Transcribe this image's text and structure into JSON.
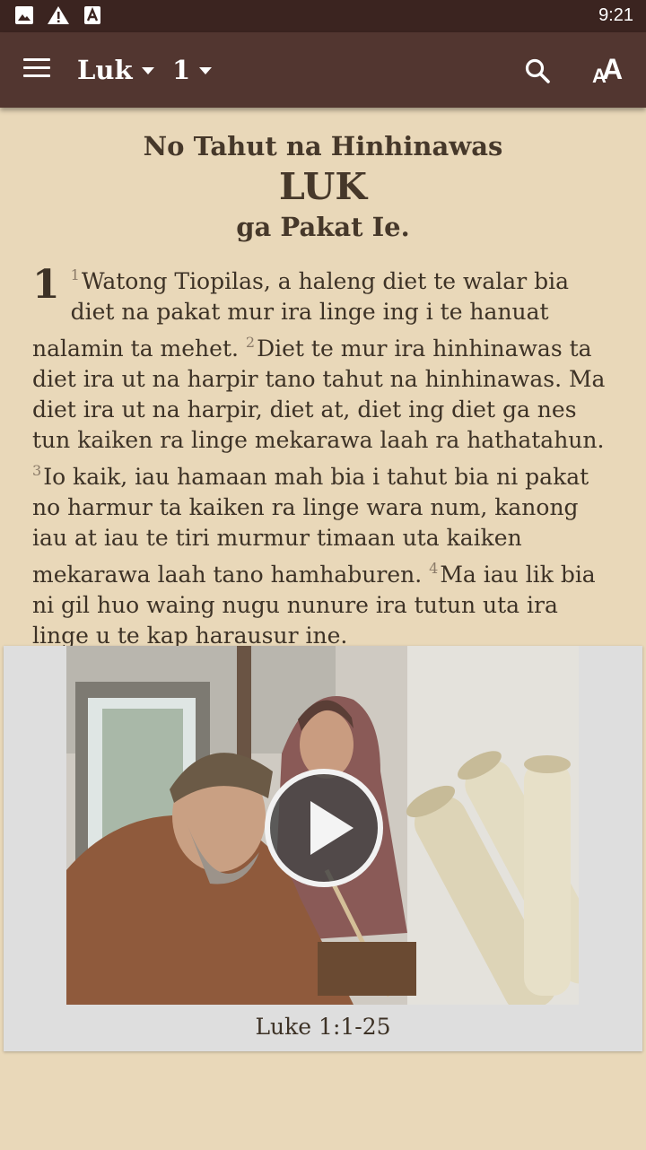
{
  "status_bar": {
    "time": "9:21",
    "icons": [
      "image-icon",
      "warning-icon",
      "font-a-icon"
    ]
  },
  "toolbar": {
    "book": "Luk",
    "chapter": "1",
    "icons": [
      "menu-icon",
      "search-icon",
      "text-size-icon"
    ]
  },
  "headings": {
    "line1": "No Tahut na Hinhinawas",
    "line2": "LUK",
    "line3": "ga Pakat Ie."
  },
  "passage": {
    "chapter_number": "1",
    "verses": [
      {
        "num": "1",
        "text": "Watong Tiopilas, a haleng diet te walar bia diet na pakat mur ira linge ing i te hanuat nalamin ta mehet."
      },
      {
        "num": "2",
        "text": "Diet te mur ira hinhinawas ta diet ira ut na harpir tano tahut na hinhinawas. Ma diet ira ut na harpir, diet at, diet ing diet ga nes tun kaiken ra linge mekarawa laah ra hathatahun."
      },
      {
        "num": "3",
        "text": "Io kaik, iau hamaan mah bia i tahut bia ni pakat no harmur ta kaiken ra linge wara num, kanong iau at iau te tiri murmur timaan uta kaiken mekarawa laah tano hamhaburen."
      },
      {
        "num": "4",
        "text": "Ma iau lik bia ni gil huo waing nugu nunure ira tutun uta ira linge u te kap harausur ine."
      }
    ]
  },
  "video": {
    "caption": "Luke 1:1-25"
  },
  "colors": {
    "statusbar": "#3b2420",
    "toolbar": "#523630",
    "page_background": "#e9d8b9",
    "text": "#3d3226",
    "video_card": "#dedede"
  }
}
